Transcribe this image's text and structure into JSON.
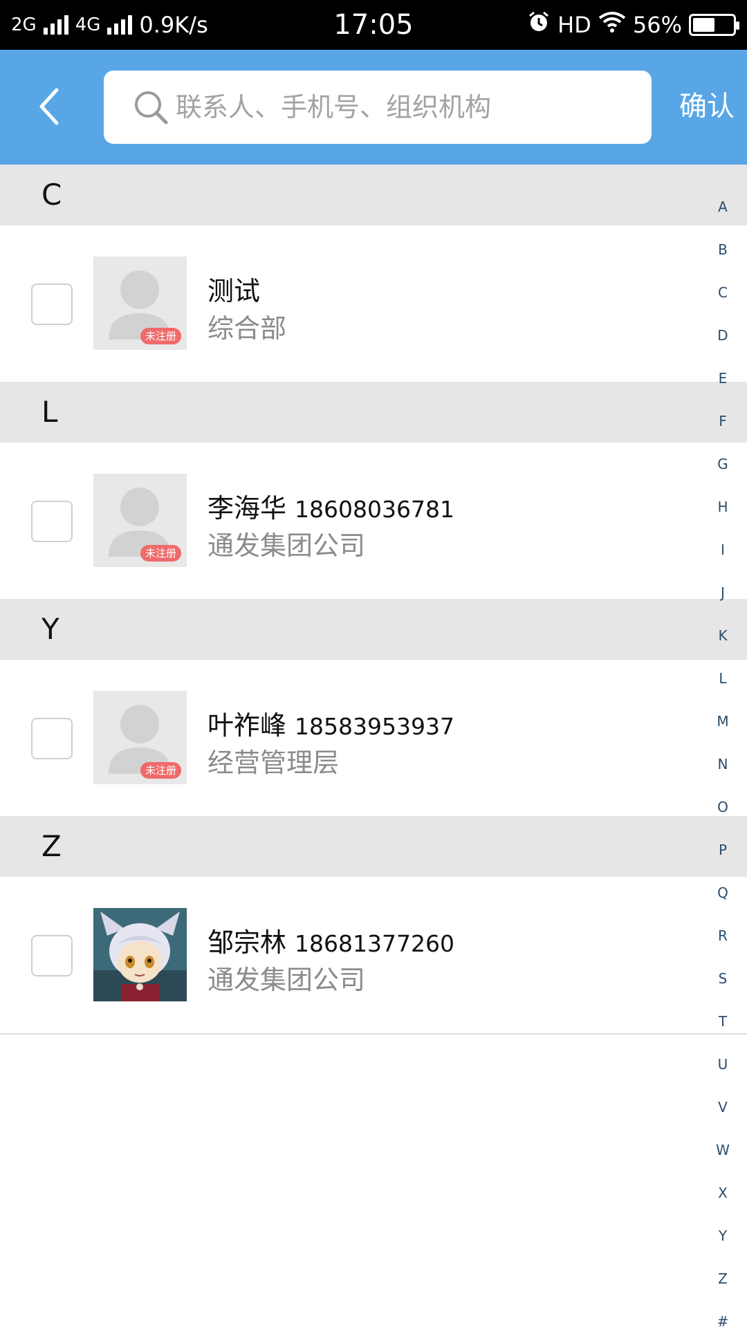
{
  "status_bar": {
    "network_1": "2G",
    "network_2": "4G",
    "speed": "0.9K/s",
    "time": "17:05",
    "hd": "HD",
    "battery": "56%",
    "battery_level": 0.56
  },
  "header": {
    "search_placeholder": "联系人、手机号、组织机构",
    "confirm_label": "确认"
  },
  "sections": [
    {
      "letter": "C",
      "contacts": [
        {
          "name": "测试",
          "phone": "",
          "dept": "综合部",
          "badge": "未注册",
          "avatar": "default-avatar"
        }
      ]
    },
    {
      "letter": "L",
      "contacts": [
        {
          "name": "李海华",
          "phone": "18608036781",
          "dept": "通发集团公司",
          "badge": "未注册",
          "avatar": "default-avatar"
        }
      ]
    },
    {
      "letter": "Y",
      "contacts": [
        {
          "name": "叶祚峰",
          "phone": "18583953937",
          "dept": "经营管理层",
          "badge": "未注册",
          "avatar": "default-avatar"
        }
      ]
    },
    {
      "letter": "Z",
      "contacts": [
        {
          "name": "邹宗林",
          "phone": "18681377260",
          "dept": "通发集团公司",
          "badge": "",
          "avatar": "anime-avatar"
        }
      ]
    }
  ],
  "index_letters": [
    "A",
    "B",
    "C",
    "D",
    "E",
    "F",
    "G",
    "H",
    "I",
    "J",
    "K",
    "L",
    "M",
    "N",
    "O",
    "P",
    "Q",
    "R",
    "S",
    "T",
    "U",
    "V",
    "W",
    "X",
    "Y",
    "Z",
    "#"
  ],
  "colors": {
    "accent": "#58a6e6",
    "section_bg": "#e6e6e6",
    "badge": "#f06a6a"
  }
}
